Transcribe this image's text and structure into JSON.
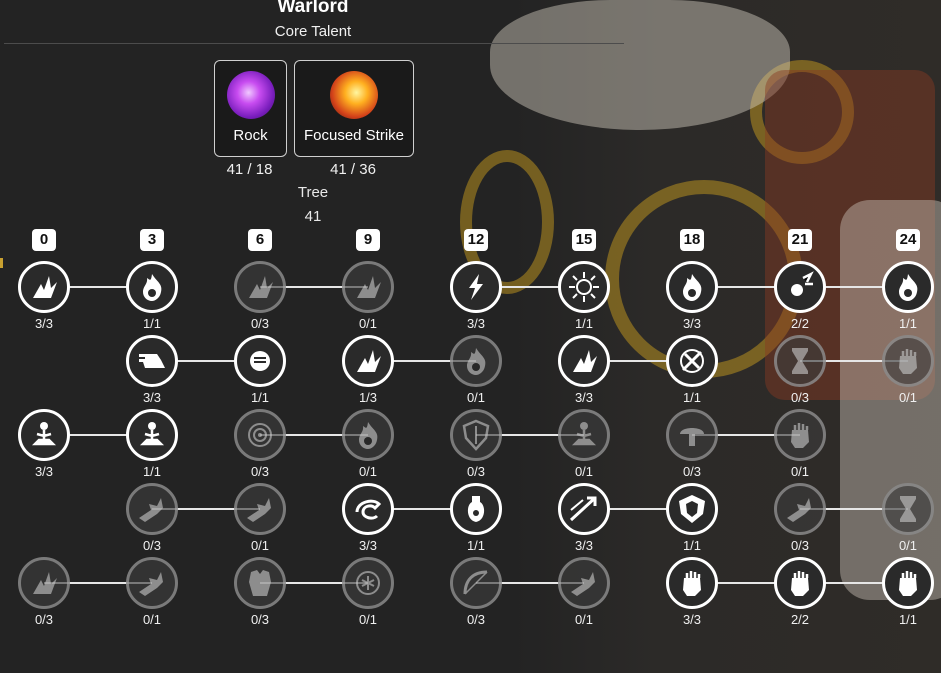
{
  "header": {
    "title": "Warlord",
    "subtitle": "Core Talent"
  },
  "core_talents": [
    {
      "label": "Rock",
      "count": "41 / 18",
      "icon": "purple-crystal-icon"
    },
    {
      "label": "Focused Strike",
      "count": "41 / 36",
      "icon": "fire-strike-icon"
    }
  ],
  "tree": {
    "label": "Tree",
    "count": "41"
  },
  "levels": [
    "0",
    "3",
    "6",
    "9",
    "12",
    "15",
    "18",
    "21",
    "24"
  ],
  "rows": [
    {
      "nodes": [
        {
          "col": 0,
          "count": "3/3",
          "active": true,
          "icon": "shatter-icon"
        },
        {
          "col": 1,
          "count": "1/1",
          "active": true,
          "icon": "flame-icon"
        },
        {
          "col": 2,
          "count": "0/3",
          "active": false,
          "icon": "shatter-icon"
        },
        {
          "col": 3,
          "count": "0/1",
          "active": false,
          "icon": "shatter-icon"
        },
        {
          "col": 4,
          "count": "3/3",
          "active": true,
          "icon": "lightning-icon"
        },
        {
          "col": 5,
          "count": "1/1",
          "active": true,
          "icon": "burst-icon"
        },
        {
          "col": 6,
          "count": "3/3",
          "active": true,
          "icon": "flame-icon"
        },
        {
          "col": 7,
          "count": "2/2",
          "active": true,
          "icon": "impact-icon"
        },
        {
          "col": 8,
          "count": "1/1",
          "active": true,
          "icon": "flame-icon"
        }
      ],
      "links": [
        [
          0,
          1
        ],
        [
          2,
          3
        ],
        [
          4,
          5
        ],
        [
          6,
          7
        ],
        [
          7,
          8
        ]
      ]
    },
    {
      "nodes": [
        {
          "col": 1,
          "count": "3/3",
          "active": true,
          "icon": "dash-boot-icon"
        },
        {
          "col": 2,
          "count": "1/1",
          "active": true,
          "icon": "fist-icon"
        },
        {
          "col": 3,
          "count": "1/3",
          "active": true,
          "icon": "shatter-icon"
        },
        {
          "col": 4,
          "count": "0/1",
          "active": false,
          "icon": "flame-icon"
        },
        {
          "col": 5,
          "count": "3/3",
          "active": true,
          "icon": "shatter-icon"
        },
        {
          "col": 6,
          "count": "1/1",
          "active": true,
          "icon": "slash-icon"
        },
        {
          "col": 7,
          "count": "0/3",
          "active": false,
          "icon": "hourglass-icon"
        },
        {
          "col": 8,
          "count": "0/1",
          "active": false,
          "icon": "gauntlet-icon"
        }
      ],
      "links": [
        [
          1,
          2
        ],
        [
          3,
          4
        ],
        [
          5,
          6
        ],
        [
          7,
          8
        ]
      ]
    },
    {
      "nodes": [
        {
          "col": 0,
          "count": "3/3",
          "active": true,
          "icon": "meditate-icon"
        },
        {
          "col": 1,
          "count": "1/1",
          "active": true,
          "icon": "meditate-icon"
        },
        {
          "col": 2,
          "count": "0/3",
          "active": false,
          "icon": "target-icon"
        },
        {
          "col": 3,
          "count": "0/1",
          "active": false,
          "icon": "flame-icon"
        },
        {
          "col": 4,
          "count": "0/3",
          "active": false,
          "icon": "shield-icon"
        },
        {
          "col": 5,
          "count": "0/1",
          "active": false,
          "icon": "meditate-icon"
        },
        {
          "col": 6,
          "count": "0/3",
          "active": false,
          "icon": "mushroom-icon"
        },
        {
          "col": 7,
          "count": "0/1",
          "active": false,
          "icon": "gauntlet-icon"
        }
      ],
      "links": [
        [
          0,
          1
        ],
        [
          2,
          3
        ],
        [
          4,
          5
        ],
        [
          6,
          7
        ]
      ]
    },
    {
      "nodes": [
        {
          "col": 1,
          "count": "0/3",
          "active": false,
          "icon": "crash-icon"
        },
        {
          "col": 2,
          "count": "0/1",
          "active": false,
          "icon": "crash-icon"
        },
        {
          "col": 3,
          "count": "3/3",
          "active": true,
          "icon": "horn-icon"
        },
        {
          "col": 4,
          "count": "1/1",
          "active": true,
          "icon": "potion-icon"
        },
        {
          "col": 5,
          "count": "3/3",
          "active": true,
          "icon": "arrow-icon"
        },
        {
          "col": 6,
          "count": "1/1",
          "active": true,
          "icon": "crest-icon"
        },
        {
          "col": 7,
          "count": "0/3",
          "active": false,
          "icon": "crash-icon"
        },
        {
          "col": 8,
          "count": "0/1",
          "active": false,
          "icon": "hourglass-icon"
        }
      ],
      "links": [
        [
          1,
          2
        ],
        [
          3,
          4
        ],
        [
          5,
          6
        ],
        [
          7,
          8
        ]
      ]
    },
    {
      "nodes": [
        {
          "col": 0,
          "count": "0/3",
          "active": false,
          "icon": "shatter-icon"
        },
        {
          "col": 1,
          "count": "0/1",
          "active": false,
          "icon": "crash-icon"
        },
        {
          "col": 2,
          "count": "0/3",
          "active": false,
          "icon": "armor-icon"
        },
        {
          "col": 3,
          "count": "0/1",
          "active": false,
          "icon": "frost-icon"
        },
        {
          "col": 4,
          "count": "0/3",
          "active": false,
          "icon": "bow-icon"
        },
        {
          "col": 5,
          "count": "0/1",
          "active": false,
          "icon": "crash-icon"
        },
        {
          "col": 6,
          "count": "3/3",
          "active": true,
          "icon": "gauntlet-icon"
        },
        {
          "col": 7,
          "count": "2/2",
          "active": true,
          "icon": "gauntlet-icon"
        },
        {
          "col": 8,
          "count": "1/1",
          "active": true,
          "icon": "gauntlet-icon"
        }
      ],
      "links": [
        [
          0,
          1
        ],
        [
          2,
          3
        ],
        [
          4,
          5
        ],
        [
          6,
          7
        ],
        [
          7,
          8
        ]
      ]
    }
  ]
}
